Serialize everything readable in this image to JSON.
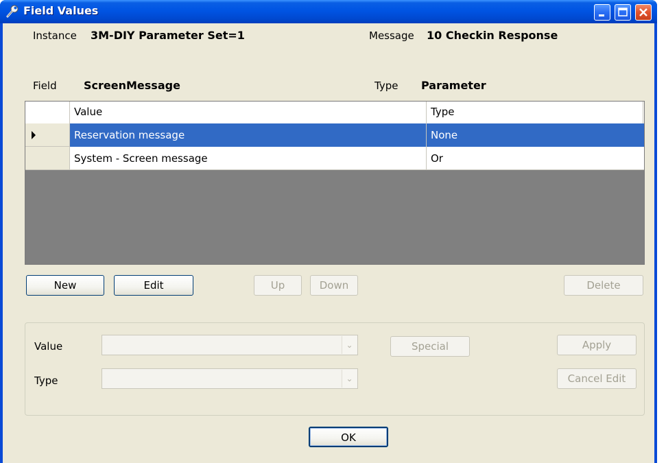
{
  "window": {
    "title": "Field Values"
  },
  "info": {
    "instance_label": "Instance",
    "instance_value": "3M-DIY Parameter Set=1",
    "message_label": "Message",
    "message_value": "10 Checkin Response",
    "field_label": "Field",
    "field_value": "ScreenMessage",
    "type_label": "Type",
    "type_value": "Parameter"
  },
  "grid": {
    "columns": [
      "Value",
      "Type"
    ],
    "rows": [
      {
        "value": "Reservation message",
        "type": "None",
        "selected": true
      },
      {
        "value": "System - Screen message",
        "type": "Or",
        "selected": false
      }
    ]
  },
  "buttons": {
    "new": "New",
    "edit": "Edit",
    "up": "Up",
    "down": "Down",
    "delete": "Delete",
    "special": "Special",
    "apply": "Apply",
    "cancel_edit": "Cancel Edit",
    "ok": "OK"
  },
  "editor": {
    "value_label": "Value",
    "type_label": "Type",
    "value_selected": "",
    "type_selected": ""
  },
  "colors": {
    "title_bar": "#0054e3",
    "selection": "#316ac5",
    "dialog_bg": "#ece9d8",
    "grid_bg": "#808080"
  },
  "icons": [
    "wrench-icon",
    "minimize-icon",
    "maximize-icon",
    "close-icon",
    "row-pointer-icon",
    "chevron-down-icon"
  ]
}
